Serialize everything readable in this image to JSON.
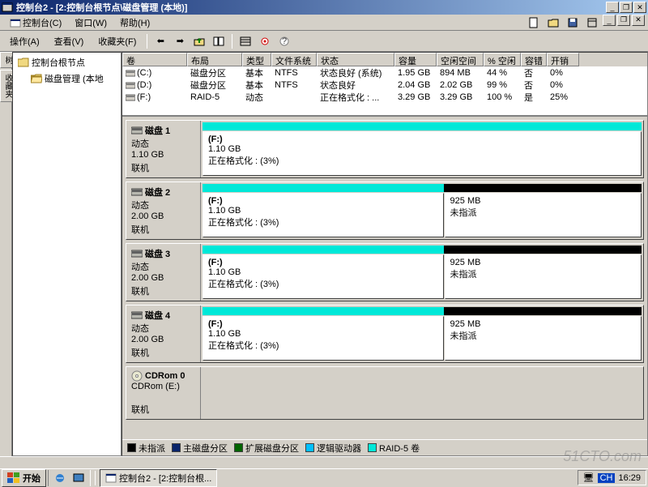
{
  "window": {
    "title": "控制台2 - [2:控制台根节点\\磁盘管理 (本地)]",
    "sys_buttons": [
      "最小化",
      "还原",
      "关闭"
    ]
  },
  "menubar": {
    "items": [
      "控制台(C)",
      "窗口(W)",
      "帮助(H)"
    ],
    "right_btns": [
      "new",
      "open",
      "save",
      "props"
    ]
  },
  "toolbar": {
    "actions": "操作(A)",
    "view": "查看(V)",
    "favorites": "收藏夹(F)"
  },
  "tree": {
    "tab_label": "树",
    "fav_tab": "收藏夹",
    "root": "控制台根节点",
    "child": "磁盘管理 (本地"
  },
  "volumes": {
    "headers": [
      "卷",
      "布局",
      "类型",
      "文件系统",
      "状态",
      "容量",
      "空闲空间",
      "% 空闲",
      "容错",
      "开销"
    ],
    "widths": [
      80,
      68,
      36,
      56,
      96,
      52,
      58,
      46,
      32,
      40
    ],
    "rows": [
      {
        "cells": [
          "(C:)",
          "磁盘分区",
          "基本",
          "NTFS",
          "状态良好 (系统)",
          "1.95 GB",
          "894 MB",
          "44 %",
          "否",
          "0%"
        ]
      },
      {
        "cells": [
          "(D:)",
          "磁盘分区",
          "基本",
          "NTFS",
          "状态良好",
          "2.04 GB",
          "2.02 GB",
          "99 %",
          "否",
          "0%"
        ]
      },
      {
        "cells": [
          "(F:)",
          "RAID-5",
          "动态",
          "",
          "正在格式化 : ...",
          "3.29 GB",
          "3.29 GB",
          "100 %",
          "是",
          "25%"
        ]
      }
    ]
  },
  "disks": [
    {
      "name": "磁盘 1",
      "type": "动态",
      "size": "1.10 GB",
      "status": "联机",
      "strip": [
        {
          "color": "#00e8d8",
          "pct": 100
        }
      ],
      "parts": [
        {
          "label": "(F:)",
          "size": "1.10 GB",
          "status": "正在格式化 : (3%)",
          "pct": 100
        }
      ]
    },
    {
      "name": "磁盘 2",
      "type": "动态",
      "size": "2.00 GB",
      "status": "联机",
      "strip": [
        {
          "color": "#00e8d8",
          "pct": 55
        },
        {
          "color": "#000",
          "pct": 45
        }
      ],
      "parts": [
        {
          "label": "(F:)",
          "size": "1.10 GB",
          "status": "正在格式化 : (3%)",
          "pct": 55
        },
        {
          "label": "",
          "size": "925 MB",
          "status": "未指派",
          "pct": 45
        }
      ]
    },
    {
      "name": "磁盘 3",
      "type": "动态",
      "size": "2.00 GB",
      "status": "联机",
      "strip": [
        {
          "color": "#00e8d8",
          "pct": 55
        },
        {
          "color": "#000",
          "pct": 45
        }
      ],
      "parts": [
        {
          "label": "(F:)",
          "size": "1.10 GB",
          "status": "正在格式化 : (3%)",
          "pct": 55
        },
        {
          "label": "",
          "size": "925 MB",
          "status": "未指派",
          "pct": 45
        }
      ]
    },
    {
      "name": "磁盘 4",
      "type": "动态",
      "size": "2.00 GB",
      "status": "联机",
      "strip": [
        {
          "color": "#00e8d8",
          "pct": 55
        },
        {
          "color": "#000",
          "pct": 45
        }
      ],
      "parts": [
        {
          "label": "(F:)",
          "size": "1.10 GB",
          "status": "正在格式化 : (3%)",
          "pct": 55
        },
        {
          "label": "",
          "size": "925 MB",
          "status": "未指派",
          "pct": 45
        }
      ]
    },
    {
      "name": "CDRom 0",
      "type": "CDRom (E:)",
      "size": "",
      "status": "联机",
      "cdrom": true,
      "strip": [],
      "parts": []
    }
  ],
  "legend": [
    {
      "color": "#000000",
      "label": "未指派"
    },
    {
      "color": "#0a246a",
      "label": "主磁盘分区"
    },
    {
      "color": "#006400",
      "label": "扩展磁盘分区"
    },
    {
      "color": "#00bfff",
      "label": "逻辑驱动器"
    },
    {
      "color": "#00e8d8",
      "label": "RAID-5 卷"
    }
  ],
  "taskbar": {
    "start": "开始",
    "task": "控制台2 - [2:控制台根...",
    "clock": "16:29",
    "ime": "CH"
  },
  "watermark": "51CTO.com"
}
